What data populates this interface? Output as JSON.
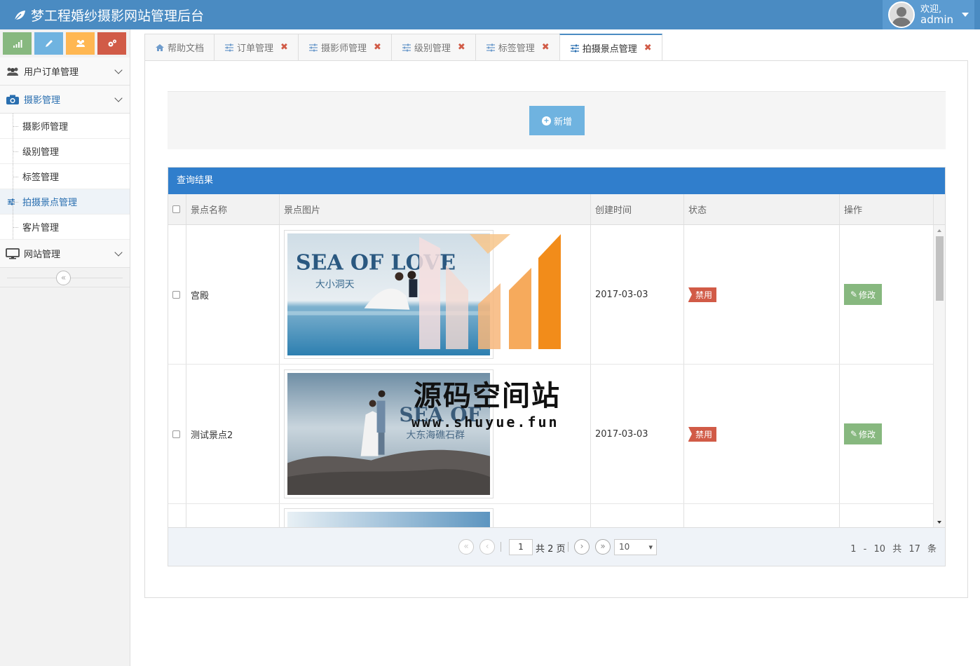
{
  "app": {
    "title": "梦工程婚纱摄影网站管理后台"
  },
  "user": {
    "greeting": "欢迎,",
    "name": "admin"
  },
  "sidebar": {
    "shortcuts": [
      {
        "icon": "signal-icon",
        "color": "#87b87f"
      },
      {
        "icon": "pencil-icon",
        "color": "#6fb3e0"
      },
      {
        "icon": "users-icon",
        "color": "#ffb752"
      },
      {
        "icon": "cogs-icon",
        "color": "#d15b47"
      }
    ],
    "groups": [
      {
        "label": "用户订单管理",
        "icon": "users-icon"
      },
      {
        "label": "摄影管理",
        "icon": "camera-icon",
        "active": true
      },
      {
        "label": "网站管理",
        "icon": "desktop-icon"
      }
    ],
    "subitems": [
      {
        "label": "摄影师管理"
      },
      {
        "label": "级别管理"
      },
      {
        "label": "标签管理"
      },
      {
        "label": "拍摄景点管理",
        "active": true
      },
      {
        "label": "客片管理"
      }
    ],
    "collapse_glyph": "«"
  },
  "tabs": [
    {
      "label": "帮助文档",
      "icon": "home-icon",
      "closable": false
    },
    {
      "label": "订单管理",
      "icon": "sliders-icon",
      "closable": true
    },
    {
      "label": "摄影师管理",
      "icon": "sliders-icon",
      "closable": true
    },
    {
      "label": "级别管理",
      "icon": "sliders-icon",
      "closable": true
    },
    {
      "label": "标签管理",
      "icon": "sliders-icon",
      "closable": true
    },
    {
      "label": "拍摄景点管理",
      "icon": "sliders-icon",
      "closable": true,
      "active": true
    }
  ],
  "tab_close_glyph": "✖",
  "toolbar": {
    "add_label": "新增"
  },
  "grid": {
    "caption": "查询结果",
    "columns": [
      "景点名称",
      "景点图片",
      "创建时间",
      "状态",
      "操作"
    ],
    "rows": [
      {
        "name": "宫殿",
        "date": "2017-03-03",
        "status": "禁用",
        "action": "修改",
        "photo": {
          "title": "SEA OF LOVE",
          "subtitle": "大小洞天",
          "theme": "sea"
        }
      },
      {
        "name": "测试景点2",
        "date": "2017-03-03",
        "status": "禁用",
        "action": "修改",
        "photo": {
          "title": "SEA OF LOVE",
          "subtitle": "大东海礁石群",
          "theme": "rocks"
        }
      }
    ]
  },
  "pager": {
    "current_page": "1",
    "total_pages_text": "共 2 页",
    "page_size": "10",
    "range_text": "1 - 10",
    "total_text": "共 17 条"
  },
  "watermark": {
    "text": "源码空间站",
    "url": "www.shuyue.fun"
  },
  "colors": {
    "topbar": "#4a8bc2",
    "caption": "#307ecc",
    "badge": "#d15b47",
    "edit": "#87b87f",
    "add": "#6fb3e0"
  }
}
